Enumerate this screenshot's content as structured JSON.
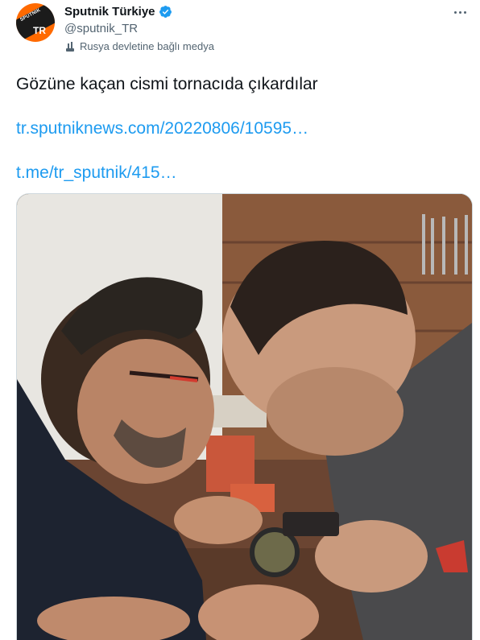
{
  "account": {
    "display_name": "Sputnik Türkiye",
    "handle": "@sputnik_TR",
    "label": "Rusya devletine bağlı medya",
    "avatar_text": "TR",
    "avatar_logo_text": "SPUTNIK",
    "brand_color": "#ff6a00"
  },
  "tweet": {
    "text": "Gözüne kaçan cismi tornacıda çıkardılar",
    "links": [
      "tr.sputniknews.com/20220806/10595…",
      "t.me/tr_sputnik/415…"
    ]
  },
  "icons": {
    "verified": "verified-badge-icon",
    "label": "government-media-icon",
    "more": "more-options-icon"
  },
  "colors": {
    "link": "#1d9bf0",
    "text": "#0f1419",
    "secondary_text": "#536471"
  }
}
